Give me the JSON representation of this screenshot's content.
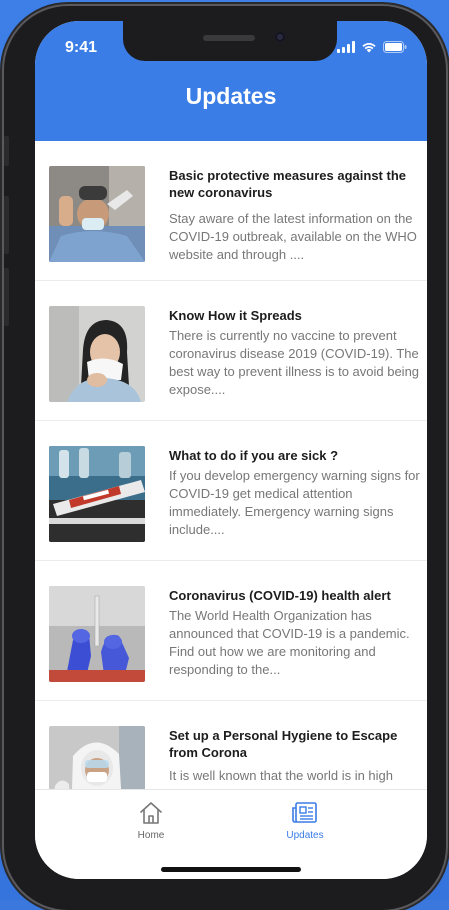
{
  "status_bar": {
    "time": "9:41"
  },
  "header": {
    "title": "Updates"
  },
  "articles": [
    {
      "title": "Basic protective measures against the new coronavirus",
      "description": "Stay aware of the latest information on the COVID-19 outbreak, available on the WHO website and through ....",
      "image": "person-temperature-check"
    },
    {
      "title": "Know How it Spreads",
      "description": "There is currently no vaccine to prevent coronavirus disease 2019 (COVID-19). The best way to prevent illness is to avoid being expose....",
      "image": "person-sneezing"
    },
    {
      "title": "What to do if you are sick ?",
      "description": "If you develop emergency warning signs for COVID-19 get medical attention immediately. Emergency warning signs include....",
      "image": "test-tube-sample"
    },
    {
      "title": "Coronavirus (COVID-19) health alert",
      "description": "The World Health Organization has announced that COVID-19 is a pandemic. Find out how we are monitoring and responding to the...",
      "image": "gloved-hands-lab"
    },
    {
      "title": "Set up a Personal Hygiene to Escape from Corona",
      "description": "It is well known that the world is in high",
      "image": "protective-suit-worker"
    }
  ],
  "tabbar": {
    "home_label": "Home",
    "updates_label": "Updates",
    "active": "updates"
  },
  "colors": {
    "accent": "#3a7de6",
    "background": "#3574dc"
  }
}
